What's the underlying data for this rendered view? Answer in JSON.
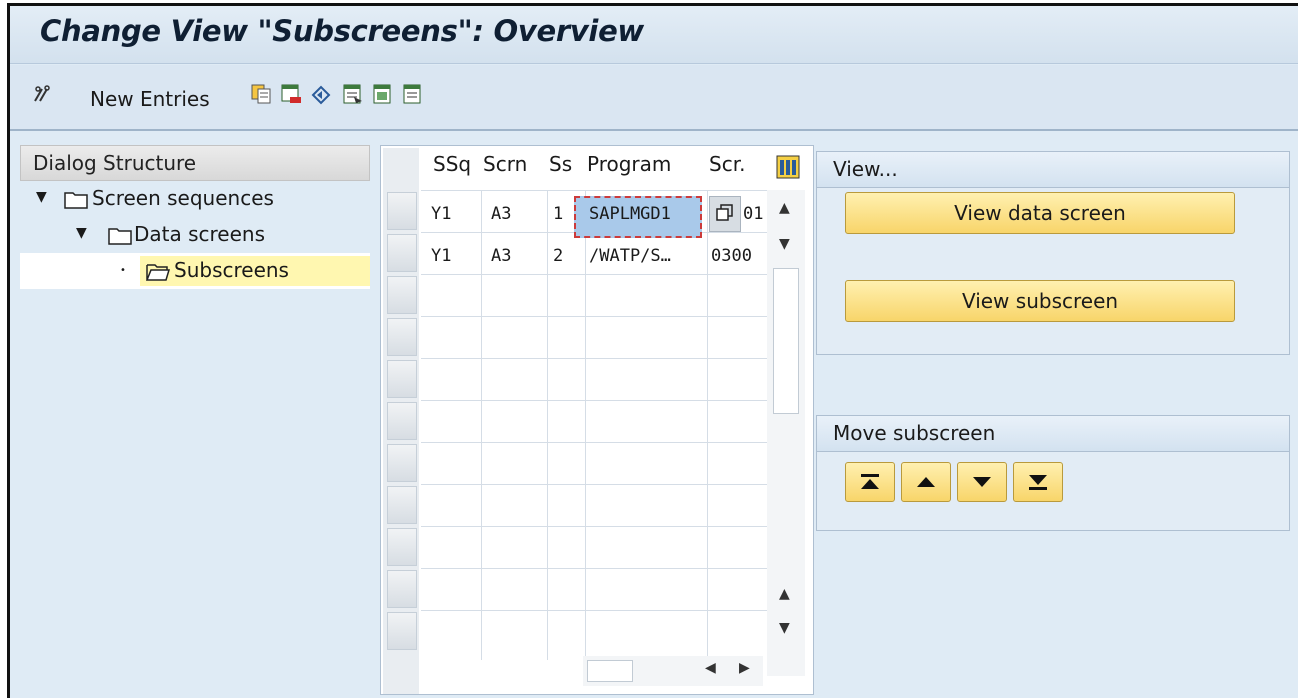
{
  "window": {
    "title": "Change View \"Subscreens\": Overview"
  },
  "toolbar": {
    "new_entries_label": "New Entries",
    "icons": [
      "edit-glasses-icon",
      "copy-icon",
      "delete-icon",
      "undo-icon",
      "select-all-icon",
      "select-block-icon",
      "deselect-all-icon"
    ]
  },
  "dialog_structure": {
    "header": "Dialog Structure",
    "items": [
      {
        "label": "Screen sequences",
        "level": 0
      },
      {
        "label": "Data screens",
        "level": 1
      },
      {
        "label": "Subscreens",
        "level": 2,
        "selected": true
      }
    ]
  },
  "table": {
    "columns": [
      "SSq",
      "Scrn",
      "Ss",
      "Program",
      "Scr."
    ],
    "rows": [
      {
        "ssq": "Y1",
        "scrn": "A3",
        "ss": "1",
        "program": "SAPLMGD1",
        "scr": "01"
      },
      {
        "ssq": "Y1",
        "scrn": "A3",
        "ss": "2",
        "program": "/WATP/S…",
        "scr": "0300"
      }
    ]
  },
  "view_group": {
    "title": "View...",
    "btn_data_screen": "View data screen",
    "btn_subscreen": "View subscreen"
  },
  "move_group": {
    "title": "Move subscreen"
  },
  "colors": {
    "accent_yellow": "#f8d56a",
    "bg": "#dfebf5",
    "selected": "#fff7b0"
  }
}
